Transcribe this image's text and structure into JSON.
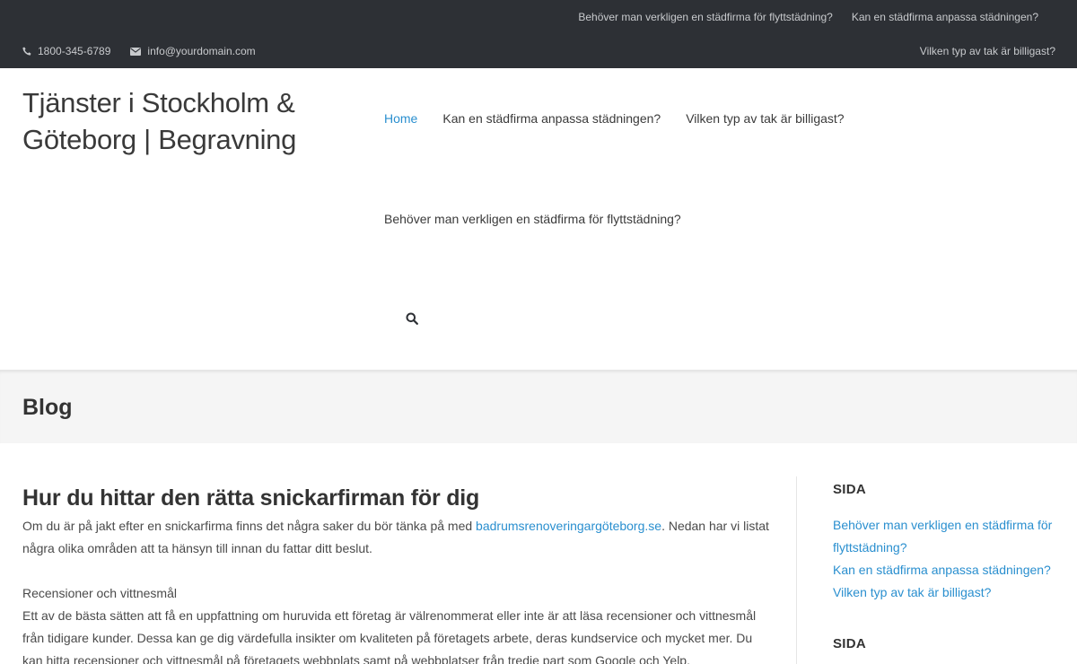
{
  "topbar": {
    "links_row1": [
      "Behöver man verkligen en städfirma för flyttstädning?",
      "Kan en städfirma anpassa städningen?"
    ],
    "link_row2": "Vilken typ av tak är billigast?",
    "phone": "1800-345-6789",
    "email": "info@yourdomain.com"
  },
  "header": {
    "site_title": "Tjänster i Stockholm & Göteborg | Begravning",
    "nav": {
      "home": "Home",
      "item2": "Kan en städfirma anpassa städningen?",
      "item3": "Vilken typ av tak är billigast?",
      "item4": "Behöver man verkligen en städfirma för flyttstädning?"
    }
  },
  "page_title": "Blog",
  "post": {
    "title": "Hur du hittar den rätta snickarfirman för dig",
    "intro_before": "Om du är på jakt efter en snickarfirma finns det några saker du bör tänka på med ",
    "intro_link": "badrumsrenoveringargöteborg.se",
    "intro_after": ". Nedan har vi listat några olika områden att ta hänsyn till innan du fattar ditt beslut.",
    "section_heading": "Recensioner och vittnesmål",
    "section_text": "Ett av de bästa sätten att få en uppfattning om huruvida ett företag är välrenommerat eller inte är att läsa recensioner och vittnesmål från tidigare kunder. Dessa kan ge dig värdefulla insikter om kvaliteten på företagets arbete, deras kundservice och mycket mer. Du kan hitta recensioner och vittnesmål på företagets webbplats samt på webbplatser från tredje part som Google och Yelp."
  },
  "sidebar": {
    "widget1_title": "SIDA",
    "widget1_links": [
      "Behöver man verkligen en städfirma för flyttstädning?",
      "Kan en städfirma anpassa städningen?",
      "Vilken typ av tak är billigast?"
    ],
    "widget2_title": "SIDA"
  },
  "colors": {
    "topbar_bg": "#2d3035",
    "accent": "#2a8fcf",
    "title_band_bg": "#f5f5f5"
  },
  "icons": [
    "phone-icon",
    "envelope-icon",
    "search-icon"
  ]
}
